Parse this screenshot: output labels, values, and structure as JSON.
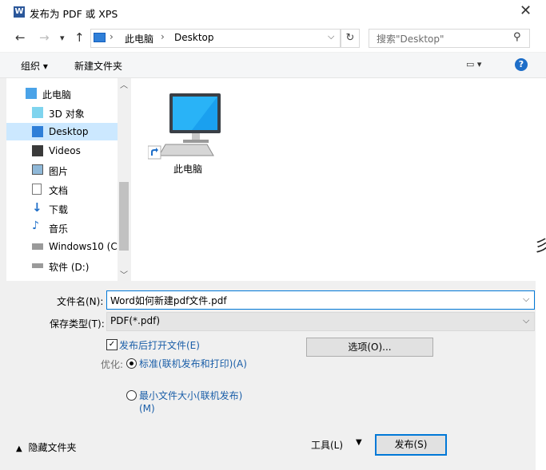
{
  "window": {
    "title": "发布为 PDF 或 XPS",
    "app_icon": "W"
  },
  "address": {
    "pc": "此电脑",
    "desktop": "Desktop",
    "search_placeholder": "搜索\"Desktop\""
  },
  "commands": {
    "organize": "组织 ▾",
    "new_folder": "新建文件夹"
  },
  "nav_items": [
    {
      "label": "此电脑",
      "icon": "pc-icon"
    },
    {
      "label": "3D 对象",
      "icon": "3d-objects-icon"
    },
    {
      "label": "Desktop",
      "icon": "desktop-icon"
    },
    {
      "label": "Videos",
      "icon": "videos-icon"
    },
    {
      "label": "图片",
      "icon": "pictures-icon"
    },
    {
      "label": "文档",
      "icon": "documents-icon"
    },
    {
      "label": "下载",
      "icon": "downloads-icon"
    },
    {
      "label": "音乐",
      "icon": "music-icon"
    },
    {
      "label": "Windows10 (C:",
      "icon": "drive-icon"
    },
    {
      "label": "软件 (D:)",
      "icon": "drive-icon"
    }
  ],
  "content_items": [
    {
      "label": "此电脑",
      "icon": "pc-shortcut-icon"
    }
  ],
  "form": {
    "filename_label": "文件名(N):",
    "filename_value": "Word如何新建pdf文件.pdf",
    "type_label": "保存类型(T):",
    "type_value": "PDF(*.pdf)",
    "open_after_label": "发布后打开文件(E)",
    "open_after_checked": true,
    "options_button": "选项(O)...",
    "optimize_label": "优化:",
    "radio_standard": "标准(联机发布和打印)(A)",
    "radio_min": "最小文件大小(联机发布)(M)",
    "selected_radio": "standard"
  },
  "footer": {
    "hide_folders": "隐藏文件夹",
    "tools": "工具(L)",
    "publish": "发布(S)"
  },
  "colors": {
    "accent": "#0078d7",
    "selection": "#cce8ff",
    "link": "#1a5ea8"
  }
}
